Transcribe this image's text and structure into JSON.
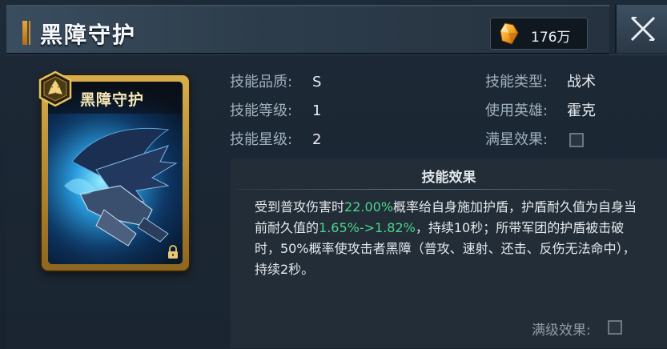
{
  "header": {
    "title": "黑障守护",
    "currency_amount": "176万"
  },
  "card": {
    "name": "黑障守护"
  },
  "info": {
    "quality_label": "技能品质:",
    "quality_value": "S",
    "level_label": "技能等级:",
    "level_value": "1",
    "star_label": "技能星级:",
    "star_value": "2",
    "type_label": "技能类型:",
    "type_value": "战术",
    "hero_label": "使用英雄:",
    "hero_value": "霍克",
    "maxstar_label": "满星效果:"
  },
  "effect": {
    "title": "技能效果",
    "text_1": "受到普攻伤害时",
    "highlight_1": "22.00%",
    "text_2": "概率给自身施加护盾，护盾耐久值为自身当前耐久值的",
    "highlight_2": "1.65%->1.82%",
    "text_3": "，持续10秒；所带军团的护盾被击破时，50%概率使攻击者黑障（普攻、速射、还击、反伤无法命中），持续2秒。",
    "maxlevel_label": "满级效果:"
  },
  "colors": {
    "highlight": "#4cd68b",
    "gold": "#d8ae4c",
    "background": "#1a2531"
  },
  "icons": [
    "gem-icon",
    "close-icon",
    "skill-badge-icon",
    "lock-icon"
  ]
}
